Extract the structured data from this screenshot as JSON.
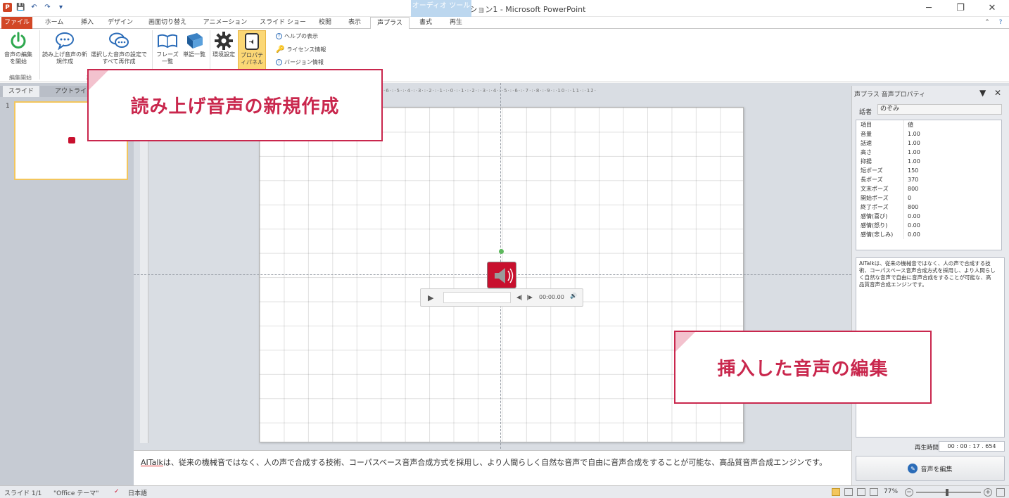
{
  "window": {
    "title": "プレゼンテーション1 - Microsoft PowerPoint",
    "context_tab_header": "オーディオ ツール",
    "controls": {
      "minimize": "─",
      "restore": "❐",
      "close": "✕"
    }
  },
  "quick_access": {
    "app_icon": "P",
    "save": "💾",
    "undo": "↶",
    "redo": "↷",
    "customize": "▾"
  },
  "tabs": [
    {
      "label": "ファイル"
    },
    {
      "label": "ホーム"
    },
    {
      "label": "挿入"
    },
    {
      "label": "デザイン"
    },
    {
      "label": "画面切り替え"
    },
    {
      "label": "アニメーション"
    },
    {
      "label": "スライド ショー"
    },
    {
      "label": "校閲"
    },
    {
      "label": "表示"
    },
    {
      "label": "声プラス"
    },
    {
      "label": "書式"
    },
    {
      "label": "再生"
    }
  ],
  "ribbon": {
    "start_edit": "音声の編集を開始",
    "group_edit": "編集開始",
    "new_read": "読み上げ音声の新規作成",
    "regen_selected": "選択した音声の設定ですべて再作成",
    "group_read": "読み上",
    "phrase_list": "フレーズ一覧",
    "word_list": "単語一覧",
    "env_settings": "環境設定",
    "property_panel": "プロパティパネル",
    "help": "ヘルプの表示",
    "license": "ライセンス情報",
    "version": "バージョン情報",
    "help_icon": "?",
    "minimize_ribbon": "⌃"
  },
  "left_panel": {
    "tabs": [
      "スライド",
      "アウトライン"
    ],
    "slide_number": "1",
    "close": "✕"
  },
  "ruler_h": "·6·:·5·:·4·:·3·:·2·:·1·:·0·:·1·:·2·:·3·:·4·:·5·:·6·:·7·:·8·:·9·:·10·:·11·:·12·",
  "player": {
    "play": "▶",
    "back": "◀|",
    "forward": "|▶",
    "time": "00:00.00",
    "volume": "🔊"
  },
  "right_pane": {
    "title": "声プラス 音声プロパティ",
    "speaker_label": "話者",
    "speaker_value": "のぞみ",
    "header_key": "項目",
    "header_value": "値",
    "properties": [
      {
        "k": "音量",
        "v": "1.00"
      },
      {
        "k": "話速",
        "v": "1.00"
      },
      {
        "k": "高さ",
        "v": "1.00"
      },
      {
        "k": "抑揚",
        "v": "1.00"
      },
      {
        "k": "短ポーズ",
        "v": "150"
      },
      {
        "k": "長ポーズ",
        "v": "370"
      },
      {
        "k": "文末ポーズ",
        "v": "800"
      },
      {
        "k": "開始ポーズ",
        "v": "0"
      },
      {
        "k": "終了ポーズ",
        "v": "800"
      },
      {
        "k": "感情(喜び)",
        "v": "0.00"
      },
      {
        "k": "感情(怒り)",
        "v": "0.00"
      },
      {
        "k": "感情(悲しみ)",
        "v": "0.00"
      }
    ],
    "description": "AITalkは、従来の機械音ではなく、人の声で合成する技術、コーパスベース音声合成方式を採用し、より人間らしく自然な音声で自由に音声合成をすることが可能な、高品質音声合成エンジンです。",
    "play_time_label": "再生時間:",
    "play_time": "00 : 00 : 17 . 654",
    "edit_button": "音声を編集"
  },
  "notes": {
    "brand": "AITalk",
    "text": "は、従来の機械音ではなく、人の声で合成する技術、コーパスベース音声合成方式を採用し、より人間らしく自然な音声で自由に音声合成をすることが可能な、高品質音声合成エンジンです。"
  },
  "status": {
    "slide": "スライド 1/1",
    "theme": "\"Office テーマ\"",
    "language": "日本語",
    "zoom": "77%"
  },
  "callouts": {
    "new_read": "読み上げ音声の新規作成",
    "edit_inserted": "挿入した音声の編集"
  },
  "colors": {
    "accent": "#c9274d",
    "file_tab": "#d24726",
    "speaker_shape": "#c8102e",
    "brand_blue": "#2b6cb8"
  }
}
